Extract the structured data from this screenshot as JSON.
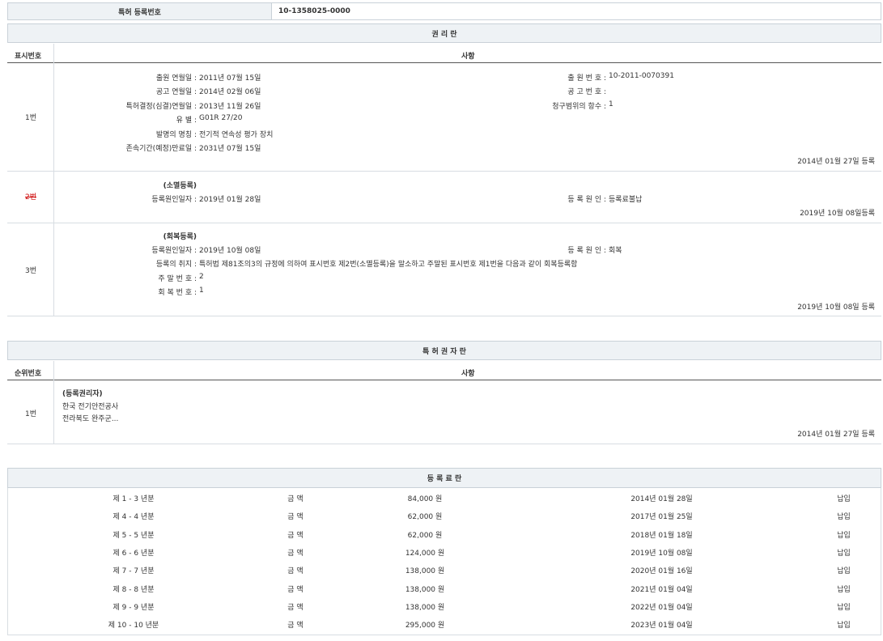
{
  "top": {
    "label": "특허 등록번호",
    "value": "10-1358025-0000"
  },
  "rights": {
    "title": "권 리 란",
    "col_num": "표시번호",
    "col_item": "사항",
    "entry1": {
      "num": "1번",
      "left": [
        {
          "label": "출원 연월일 :",
          "value": "2011년 07월 15일"
        },
        {
          "label": "공고 연월일 :",
          "value": "2014년 02월 06일"
        },
        {
          "label": "특허결정(심결)연월일 :",
          "value": "2013년 11월 26일"
        },
        {
          "label": "유 별 :",
          "value": "G01R 27/20"
        },
        {
          "label": "발명의 명칭 :",
          "value": "전기적 연속성 평가 장치"
        },
        {
          "label": "존속기간(예정)만료일 :",
          "value": "2031년 07월 15일"
        }
      ],
      "right": [
        {
          "label": "출 원 번 호 :",
          "value": "10-2011-0070391"
        },
        {
          "label": "공 고 번 호 :",
          "value": ""
        },
        {
          "label": "청구범위의 항수 :",
          "value": "1"
        }
      ],
      "reg": "2014년 01월 27일 등록"
    },
    "entry2": {
      "num": "2번",
      "heading": "(소멸등록)",
      "left_label": "등록원인일자 :",
      "left_value": "2019년 01월 28일",
      "right_label": "등 록 원 인 :",
      "right_value": "등록료불납",
      "reg": "2019년 10월 08일등록"
    },
    "entry3": {
      "num": "3번",
      "heading": "(회복등록)",
      "rows": [
        {
          "label": "등록원인일자 :",
          "value": "2019년 10월 08일"
        },
        {
          "label": "등록의 취지 :",
          "value": "특허법 제81조의3의 규정에 의하여 표시번호 제2번(소멸등록)을 말소하고 주말된 표시번호 제1번을 다음과 같이 회복등록함"
        },
        {
          "label": "주 말 번 호 :",
          "value": "2"
        },
        {
          "label": "회 복 번 호 :",
          "value": "1"
        }
      ],
      "right_label": "등 록 원 인 :",
      "right_value": "회복",
      "reg": "2019년 10월 08일 등록"
    }
  },
  "holders": {
    "title": "특 허 권 자 란",
    "col_num": "순위번호",
    "col_item": "사항",
    "num": "1번",
    "lines": [
      "(등록권리자)",
      "한국 전기안전공사",
      "전라북도 완주군..."
    ],
    "reg": "2014년 01월 27일 등록"
  },
  "fees": {
    "title": "등 록 료 란",
    "rows": [
      {
        "period": "제 1 - 3 년분",
        "label": "금 액",
        "amount": "84,000 원",
        "date": "2014년 01월 28일",
        "status": "납입"
      },
      {
        "period": "제 4 - 4 년분",
        "label": "금 액",
        "amount": "62,000 원",
        "date": "2017년 01월 25일",
        "status": "납입"
      },
      {
        "period": "제 5 - 5 년분",
        "label": "금 액",
        "amount": "62,000 원",
        "date": "2018년 01월 18일",
        "status": "납입"
      },
      {
        "period": "제 6 - 6 년분",
        "label": "금 액",
        "amount": "124,000 원",
        "date": "2019년 10월 08일",
        "status": "납입"
      },
      {
        "period": "제 7 - 7 년분",
        "label": "금 액",
        "amount": "138,000 원",
        "date": "2020년 01월 16일",
        "status": "납입"
      },
      {
        "period": "제 8 - 8 년분",
        "label": "금 액",
        "amount": "138,000 원",
        "date": "2021년 01월 04일",
        "status": "납입"
      },
      {
        "period": "제 9 - 9 년분",
        "label": "금 액",
        "amount": "138,000 원",
        "date": "2022년 01월 04일",
        "status": "납입"
      },
      {
        "period": "제 10 - 10 년분",
        "label": "금 액",
        "amount": "295,000 원",
        "date": "2023년 01월 04일",
        "status": "납입"
      }
    ]
  }
}
